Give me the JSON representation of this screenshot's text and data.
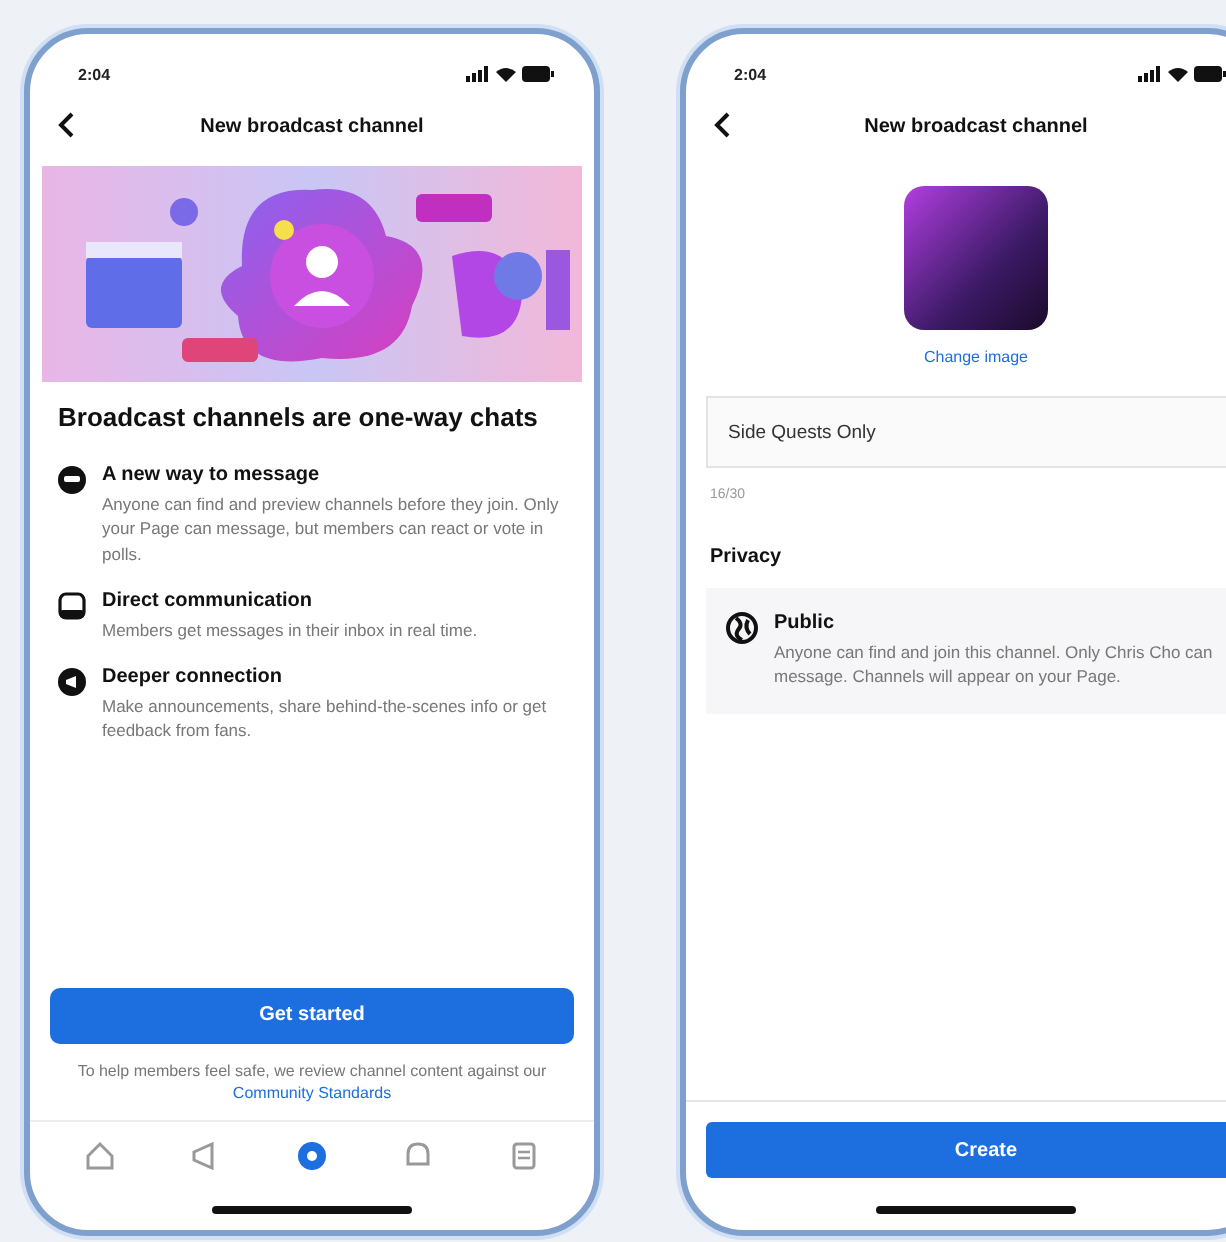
{
  "intro_screen": {
    "status_time": "2:04",
    "title": "New broadcast channel",
    "heading": "Broadcast channels are one-way chats",
    "features": [
      {
        "title": "A new way to message",
        "text": "Anyone can find and preview channels before they join. Only your Page can message, but members can react or vote in polls."
      },
      {
        "title": "Direct communication",
        "text": "Members get messages in their inbox in real time."
      },
      {
        "title": "Deeper connection",
        "text": "Make announcements, share behind-the-scenes info or get feedback from fans."
      }
    ],
    "primary_button": "Get started",
    "footer_text": "To help members feel safe, we review channel content against our",
    "footer_link": "Community Standards",
    "tabs": [
      {
        "selected": false
      },
      {
        "selected": false
      },
      {
        "selected": true
      },
      {
        "selected": false
      },
      {
        "selected": false
      }
    ]
  },
  "create_screen": {
    "status_time": "2:04",
    "title": "New broadcast channel",
    "change_image": "Change image",
    "name_field": {
      "value": "Side Quests Only"
    },
    "counter": "16/30",
    "privacy_label": "Privacy",
    "privacy_option": {
      "title": "Public",
      "text": "Anyone can find and join this channel. Only Chris Cho can message. Channels will appear on your Page."
    },
    "primary_button": "Create"
  }
}
